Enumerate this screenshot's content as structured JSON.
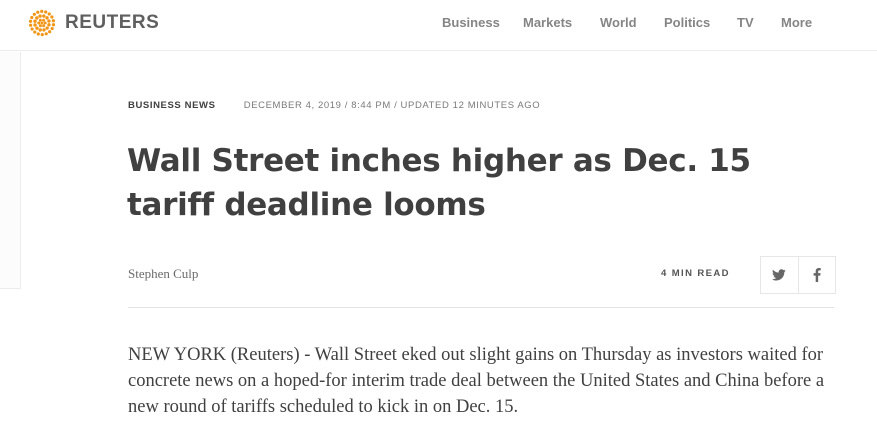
{
  "header": {
    "brand": "REUTERS",
    "nav": [
      {
        "label": "Business"
      },
      {
        "label": "Markets"
      },
      {
        "label": "World"
      },
      {
        "label": "Politics"
      },
      {
        "label": "TV"
      },
      {
        "label": "More"
      }
    ]
  },
  "article": {
    "section": "BUSINESS NEWS",
    "dateline": "DECEMBER 4, 2019 / 8:44 PM / UPDATED 12 MINUTES AGO",
    "headline": "Wall Street inches higher as Dec. 15 tariff deadline looms",
    "author": "Stephen Culp",
    "read_time": "4 MIN READ",
    "share": [
      {
        "icon": "twitter-icon"
      },
      {
        "icon": "facebook-icon"
      }
    ],
    "lede": "NEW YORK (Reuters) - Wall Street eked out slight gains on Thursday as investors waited for concrete news on a hoped-for interim trade deal between the United States and China before a new round of tariffs scheduled to kick in on Dec. 15."
  },
  "colors": {
    "brand_orange": "#f29516",
    "nav_text": "#858585",
    "headline_text": "#404040"
  }
}
